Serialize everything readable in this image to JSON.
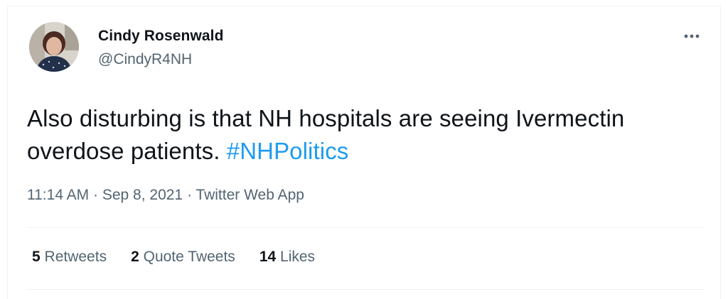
{
  "tweet": {
    "display_name": "Cindy Rosenwald",
    "handle": "@CindyR4NH",
    "more_icon": "more-horizontal-icon",
    "text_main": "Also disturbing is that NH hospitals are seeing Ivermectin overdose patients. ",
    "hashtag": "#NHPolitics",
    "time": "11:14 AM",
    "separator": " · ",
    "date": "Sep 8, 2021",
    "source": "Twitter Web App",
    "accent_color": "#1d9bf0",
    "secondary_color": "#536471"
  },
  "stats": {
    "retweets_count": "5",
    "retweets_label": "Retweets",
    "quotes_count": "2",
    "quotes_label": "Quote Tweets",
    "likes_count": "14",
    "likes_label": "Likes"
  }
}
